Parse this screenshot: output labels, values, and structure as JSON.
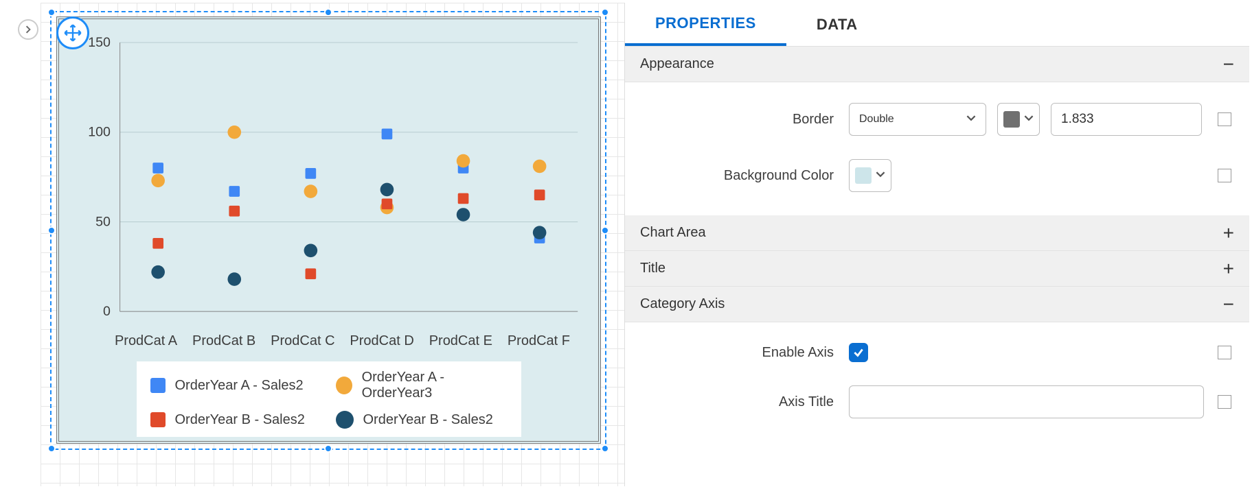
{
  "panel": {
    "tabs": {
      "properties": "PROPERTIES",
      "data": "DATA",
      "active": "properties"
    },
    "sections": {
      "appearance": {
        "title": "Appearance",
        "expanded": true,
        "border": {
          "label": "Border",
          "style_options_selected": "Double",
          "color": "#707070",
          "width_value": "1.833"
        },
        "background": {
          "label": "Background Color",
          "color": "#cde5ea"
        }
      },
      "chart_area": {
        "title": "Chart Area",
        "expanded": false
      },
      "title_sec": {
        "title": "Title",
        "expanded": false
      },
      "category_axis": {
        "title": "Category Axis",
        "expanded": true,
        "enable": {
          "label": "Enable Axis",
          "value": true
        },
        "axis_title": {
          "label": "Axis Title",
          "value": ""
        }
      }
    }
  },
  "chart_data": {
    "type": "scatter",
    "categories": [
      "ProdCat A",
      "ProdCat B",
      "ProdCat C",
      "ProdCat D",
      "ProdCat E",
      "ProdCat F"
    ],
    "ylim": [
      0,
      150
    ],
    "yticks": [
      0,
      50,
      100,
      150
    ],
    "series": [
      {
        "name": "OrderYear A - Sales2",
        "shape": "square",
        "color": "#3f87f5",
        "values": [
          80,
          67,
          77,
          99,
          80,
          41
        ]
      },
      {
        "name": "OrderYear A - OrderYear3",
        "shape": "circle",
        "color": "#f2a93b",
        "values": [
          73,
          100,
          67,
          58,
          84,
          81
        ]
      },
      {
        "name": "OrderYear B - Sales2",
        "shape": "square",
        "color": "#e04a2a",
        "values": [
          38,
          56,
          21,
          60,
          63,
          65
        ]
      },
      {
        "name": "OrderYear B - Sales2",
        "shape": "circle",
        "color": "#1e506e",
        "values": [
          22,
          18,
          34,
          68,
          54,
          44
        ]
      }
    ]
  },
  "colors": {
    "accent": "#0a6ed1",
    "selection": "#1d8cf8",
    "chart_bg": "#dcecef"
  }
}
